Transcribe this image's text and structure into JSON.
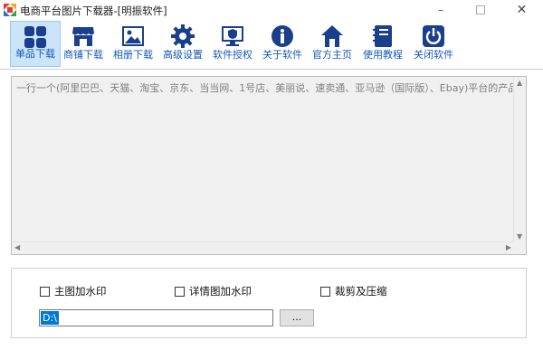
{
  "window": {
    "title": "电商平台图片下载器-[明振软件]",
    "min_icon": "minimize-icon",
    "max_icon": "maximize-icon",
    "close_icon": "close-icon"
  },
  "toolbar": {
    "items": [
      {
        "label": "单品下载",
        "icon": "grid-icon",
        "active": true
      },
      {
        "label": "商铺下载",
        "icon": "shop-icon",
        "active": false
      },
      {
        "label": "相册下载",
        "icon": "image-icon",
        "active": false
      },
      {
        "label": "高级设置",
        "icon": "gear-icon",
        "active": false
      },
      {
        "label": "软件授权",
        "icon": "monitor-shield-icon",
        "active": false
      },
      {
        "label": "关于软件",
        "icon": "info-icon",
        "active": false
      },
      {
        "label": "官方主页",
        "icon": "home-icon",
        "active": false
      },
      {
        "label": "使用教程",
        "icon": "book-icon",
        "active": false
      },
      {
        "label": "关闭软件",
        "icon": "power-icon",
        "active": false
      }
    ],
    "icon_color": "#1a3f8c",
    "label_color": "#1458b8",
    "active_bg": "#cce4f7"
  },
  "input_area": {
    "placeholder": "一行一个(阿里巴巴、天猫、淘宝、京东、当当网、1号店、美丽说、速卖通、亚马逊（国际版）、Ebay)平台的产品链接"
  },
  "options": {
    "main_watermark": "主图加水印",
    "detail_watermark": "详情图加水印",
    "crop_compress": "裁剪及压缩",
    "save_path": "D:\\",
    "browse_label": "..."
  }
}
